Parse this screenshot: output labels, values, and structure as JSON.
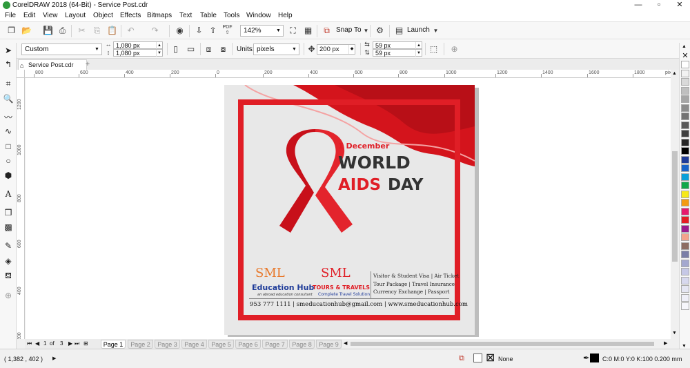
{
  "window": {
    "title": "CorelDRAW 2018 (64-Bit) - Service Post.cdr",
    "minimize": "—",
    "restore": "▫",
    "close": "✕"
  },
  "menu": [
    "File",
    "Edit",
    "View",
    "Layout",
    "Object",
    "Effects",
    "Bitmaps",
    "Text",
    "Table",
    "Tools",
    "Window",
    "Help"
  ],
  "toolbar": {
    "zoom": "142%",
    "snap_to": "Snap To",
    "launch": "Launch"
  },
  "propbar": {
    "preset": "Custom",
    "width": "1,080 px",
    "height": "1,080 px",
    "units_label": "Units:",
    "units": "pixels",
    "nudge": "200 px",
    "dup_x": "59 px",
    "dup_y": "59 px"
  },
  "document": {
    "tab_label": "Service Post.cdr"
  },
  "ruler": {
    "h_labels": [
      "800",
      "600",
      "400",
      "200",
      "0",
      "200",
      "400",
      "600",
      "800",
      "1000",
      "1200",
      "1400",
      "1600",
      "1800"
    ],
    "units": "pixels",
    "v_labels": [
      "1200",
      "1000",
      "800",
      "600",
      "400",
      "200"
    ]
  },
  "poster": {
    "date": "1 December",
    "line1": "WORLD",
    "line2_red": "AIDS",
    "line2_dark": "DAY",
    "logo1_mark": "SML",
    "logo1_name": "Education Hub",
    "logo1_tagline": "an abroad education consultant",
    "logo2_mark": "SML",
    "logo2_name": "TOURS & TRAVELS",
    "logo2_tagline": "Complete Travel Solution",
    "services": [
      "Visitor & Student Visa  |  Air Ticket",
      "Tour Package  |  Travel Insurance",
      "Currency Exchange  |  Passport"
    ],
    "contact": "953 777 1111  |  smeducationhub@gmail.com  |  www.smeducationhub.com"
  },
  "pagenav": {
    "current": "1",
    "of": "of",
    "total": "3",
    "pages": [
      "Page 1",
      "Page 2",
      "Page 3",
      "Page 4",
      "Page 5",
      "Page 6",
      "Page 7",
      "Page 8",
      "Page 9"
    ]
  },
  "status": {
    "coords": "( 1,382 , 402 )",
    "fill": "None",
    "outline": "C:0 M:0 Y:0 K:100  0.200 mm"
  },
  "palette_colors": [
    "#ffffff",
    "#f2f2f2",
    "#d9d9d9",
    "#bfbfbf",
    "#a6a6a6",
    "#8c8c8c",
    "#737373",
    "#595959",
    "#404040",
    "#262626",
    "#000000",
    "#1f3c99",
    "#1863c9",
    "#0aa0d9",
    "#11a84a",
    "#f6e91a",
    "#f39c12",
    "#e61b6c",
    "#e31e24",
    "#9b1c8e",
    "#f4a28c",
    "#8d6e63",
    "#7b7fa8",
    "#a4a8cf",
    "#c6c8e6",
    "#d7d8ee",
    "#e5e6f3",
    "#efeff8",
    "#f6f6fb"
  ]
}
